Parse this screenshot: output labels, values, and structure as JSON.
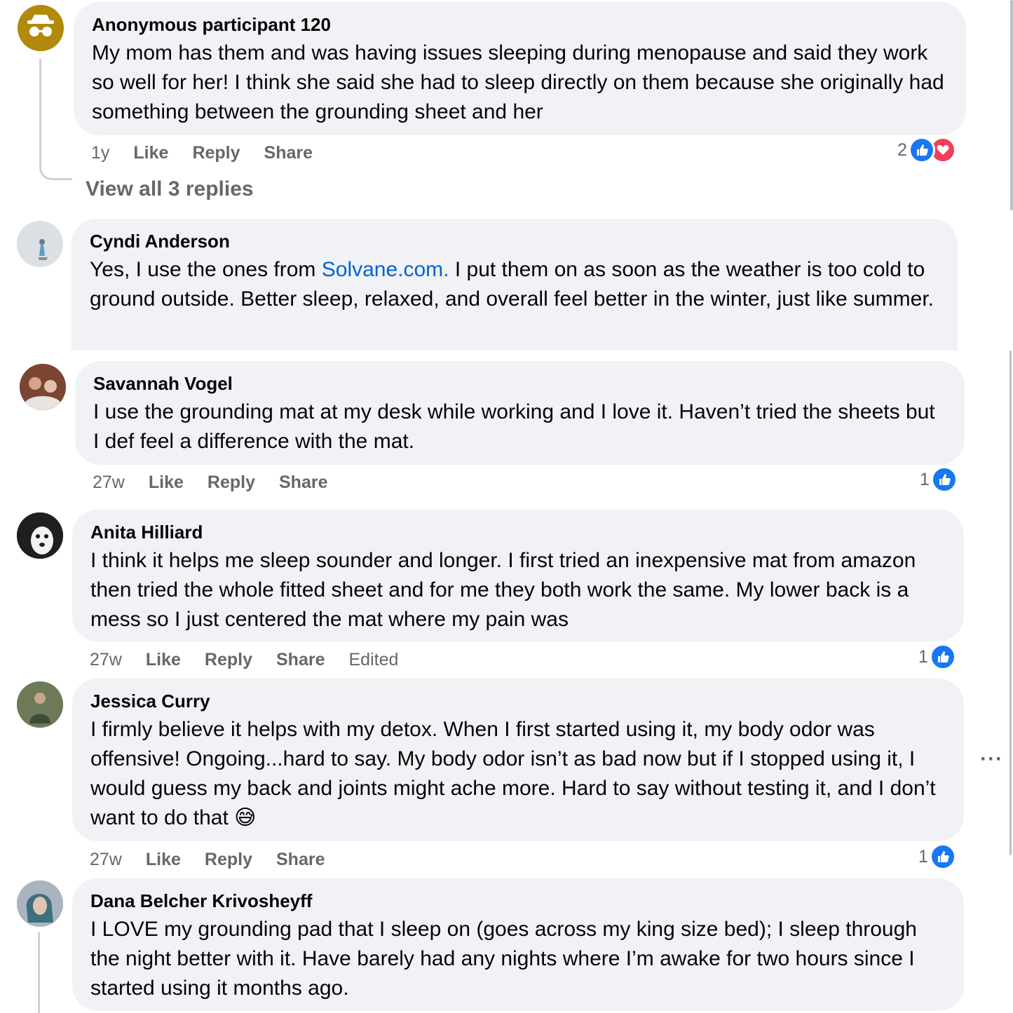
{
  "comments": [
    {
      "author": "Anonymous participant 120",
      "text": "My mom has them and was having issues sleeping during menopause and said they work so well for her! I think she said she had to sleep directly on them because she originally had something between the grounding sheet and her",
      "time": "1y",
      "like": "Like",
      "reply": "Reply",
      "share": "Share",
      "reaction_count": "2",
      "reactions": [
        "like-icon",
        "love-icon"
      ],
      "view_replies": "View all 3 replies",
      "avatar": "anonymous-avatar"
    },
    {
      "author": "Cyndi Anderson",
      "text_before": "Yes, I use the ones from ",
      "link": "Solvane.com.",
      "text_after": " I put them on as soon as the weather is too cold to ground outside. Better sleep, relaxed, and overall feel better in the winter, just like summer.",
      "avatar": "user-avatar"
    },
    {
      "author": "Savannah Vogel",
      "text": "I use the grounding mat at my desk while working and I love it. Haven’t tried the sheets but I def feel a difference with the mat.",
      "time": "27w",
      "like": "Like",
      "reply": "Reply",
      "share": "Share",
      "reaction_count": "1",
      "reactions": [
        "like-icon"
      ]
    },
    {
      "author": "Anita Hilliard",
      "text": "I think it helps me sleep sounder and longer. I first tried an inexpensive mat from amazon then tried the whole fitted sheet and for me they both work the same. My lower back is a mess so I just centered the mat where my pain was",
      "time": "27w",
      "like": "Like",
      "reply": "Reply",
      "share": "Share",
      "edited": "Edited",
      "reaction_count": "1",
      "reactions": [
        "like-icon"
      ]
    },
    {
      "author": "Jessica Curry",
      "text": "I firmly believe it helps with my detox. When I first started using it, my body odor was offensive! Ongoing...hard to say. My body odor isn’t as bad now but if I stopped using it, I would guess my back and joints might ache more. Hard to say without testing it, and I don’t want to do that",
      "emoji": "😅",
      "time": "27w",
      "like": "Like",
      "reply": "Reply",
      "share": "Share",
      "reaction_count": "1",
      "reactions": [
        "like-icon"
      ],
      "more": "···"
    },
    {
      "author": "Dana Belcher Krivosheyff",
      "text": "I LOVE my grounding pad that I sleep on (goes across my king size bed); I sleep through the night better with it. Have barely had any nights where I’m awake for two hours since I started using it months ago."
    }
  ],
  "colors": {
    "bubble": "#f0f2f5",
    "like_blue": "#1877f2",
    "love_red": "#f33e58",
    "link": "#0064d1",
    "meta_gray": "#65676b"
  }
}
